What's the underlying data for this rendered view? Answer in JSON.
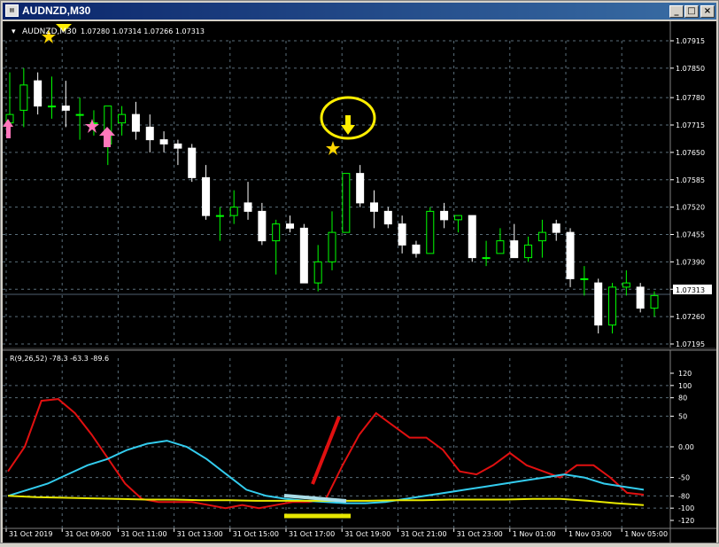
{
  "window": {
    "title": "AUDNZD,M30",
    "icon": "chart-window-icon",
    "buttons": {
      "minimize": "_",
      "maximize": "□",
      "close": "×"
    }
  },
  "header": {
    "symbol": "AUDNZD,M30",
    "ohlc": "1.07280 1.07314 1.07266 1.07313"
  },
  "indicator": {
    "label": "R(9,26,52) -78.3 -63.3 -89.6"
  },
  "current_price": "1.07313",
  "colors": {
    "bull": "#00ff00",
    "bear": "#ffffff",
    "grid": "#5a6e7a",
    "red": "#e01010",
    "cyan": "#33ccee",
    "yellow": "#e8e800",
    "pink": "#ff77bb",
    "star": "#ffd700",
    "circle": "#ffee00"
  },
  "chart_data": [
    {
      "type": "candlestick",
      "x": [
        "31 Oct 2019",
        "31 Oct 09:00",
        "31 Oct 11:00",
        "31 Oct 13:00",
        "31 Oct 15:00",
        "31 Oct 17:00",
        "31 Oct 19:00",
        "31 Oct 21:00",
        "31 Oct 23:00",
        "1 Nov 01:00",
        "1 Nov 03:00",
        "1 Nov 05:00"
      ],
      "y_ticks": [
        "1.07915",
        "1.07850",
        "1.07780",
        "1.07715",
        "1.07650",
        "1.07585",
        "1.07520",
        "1.07455",
        "1.07390",
        "1.07325",
        "1.07260",
        "1.07195"
      ],
      "ylim": [
        1.07195,
        1.07915
      ],
      "candles": [
        {
          "o": 1.0772,
          "h": 1.0784,
          "l": 1.0769,
          "c": 1.0774
        },
        {
          "o": 1.0775,
          "h": 1.0785,
          "l": 1.0771,
          "c": 1.0781
        },
        {
          "o": 1.0782,
          "h": 1.0784,
          "l": 1.0774,
          "c": 1.0776
        },
        {
          "o": 1.0776,
          "h": 1.0783,
          "l": 1.0773,
          "c": 1.0776
        },
        {
          "o": 1.0776,
          "h": 1.0782,
          "l": 1.0771,
          "c": 1.0775
        },
        {
          "o": 1.0774,
          "h": 1.0778,
          "l": 1.0768,
          "c": 1.0774
        },
        {
          "o": 1.0772,
          "h": 1.0775,
          "l": 1.0769,
          "c": 1.0772
        },
        {
          "o": 1.0767,
          "h": 1.0776,
          "l": 1.0762,
          "c": 1.0776
        },
        {
          "o": 1.0772,
          "h": 1.0776,
          "l": 1.0769,
          "c": 1.0774
        },
        {
          "o": 1.0774,
          "h": 1.0777,
          "l": 1.0768,
          "c": 1.077
        },
        {
          "o": 1.0771,
          "h": 1.0774,
          "l": 1.0765,
          "c": 1.0768
        },
        {
          "o": 1.0768,
          "h": 1.077,
          "l": 1.0765,
          "c": 1.0767
        },
        {
          "o": 1.0767,
          "h": 1.0768,
          "l": 1.0762,
          "c": 1.0766
        },
        {
          "o": 1.0766,
          "h": 1.0767,
          "l": 1.0758,
          "c": 1.0759
        },
        {
          "o": 1.0759,
          "h": 1.0762,
          "l": 1.0749,
          "c": 1.075
        },
        {
          "o": 1.075,
          "h": 1.0752,
          "l": 1.0744,
          "c": 1.075
        },
        {
          "o": 1.075,
          "h": 1.0756,
          "l": 1.0748,
          "c": 1.0752
        },
        {
          "o": 1.0753,
          "h": 1.0758,
          "l": 1.0749,
          "c": 1.0751
        },
        {
          "o": 1.0751,
          "h": 1.0753,
          "l": 1.0743,
          "c": 1.0744
        },
        {
          "o": 1.0744,
          "h": 1.0749,
          "l": 1.0736,
          "c": 1.0748
        },
        {
          "o": 1.0748,
          "h": 1.075,
          "l": 1.0746,
          "c": 1.0747
        },
        {
          "o": 1.0747,
          "h": 1.0748,
          "l": 1.0734,
          "c": 1.0734
        },
        {
          "o": 1.0734,
          "h": 1.0743,
          "l": 1.0732,
          "c": 1.0739
        },
        {
          "o": 1.0739,
          "h": 1.0751,
          "l": 1.0737,
          "c": 1.0746
        },
        {
          "o": 1.0746,
          "h": 1.076,
          "l": 1.0746,
          "c": 1.076
        },
        {
          "o": 1.076,
          "h": 1.0762,
          "l": 1.0752,
          "c": 1.0753
        },
        {
          "o": 1.0753,
          "h": 1.0756,
          "l": 1.0747,
          "c": 1.0751
        },
        {
          "o": 1.0751,
          "h": 1.0752,
          "l": 1.0747,
          "c": 1.0748
        },
        {
          "o": 1.0748,
          "h": 1.075,
          "l": 1.0741,
          "c": 1.0743
        },
        {
          "o": 1.0743,
          "h": 1.0744,
          "l": 1.074,
          "c": 1.0741
        },
        {
          "o": 1.0741,
          "h": 1.0752,
          "l": 1.0741,
          "c": 1.0751
        },
        {
          "o": 1.0751,
          "h": 1.0753,
          "l": 1.0747,
          "c": 1.0749
        },
        {
          "o": 1.0749,
          "h": 1.075,
          "l": 1.0746,
          "c": 1.075
        },
        {
          "o": 1.075,
          "h": 1.075,
          "l": 1.0739,
          "c": 1.074
        },
        {
          "o": 1.074,
          "h": 1.0744,
          "l": 1.0738,
          "c": 1.074
        },
        {
          "o": 1.0741,
          "h": 1.0747,
          "l": 1.0741,
          "c": 1.0744
        },
        {
          "o": 1.0744,
          "h": 1.0748,
          "l": 1.074,
          "c": 1.074
        },
        {
          "o": 1.074,
          "h": 1.0745,
          "l": 1.0739,
          "c": 1.0743
        },
        {
          "o": 1.0744,
          "h": 1.0749,
          "l": 1.074,
          "c": 1.0746
        },
        {
          "o": 1.0748,
          "h": 1.0749,
          "l": 1.0744,
          "c": 1.0746
        },
        {
          "o": 1.0746,
          "h": 1.0747,
          "l": 1.0733,
          "c": 1.0735
        },
        {
          "o": 1.0735,
          "h": 1.0738,
          "l": 1.0731,
          "c": 1.0735
        },
        {
          "o": 1.0734,
          "h": 1.0735,
          "l": 1.0722,
          "c": 1.0724
        },
        {
          "o": 1.0724,
          "h": 1.0734,
          "l": 1.0722,
          "c": 1.0733
        },
        {
          "o": 1.0733,
          "h": 1.0737,
          "l": 1.0731,
          "c": 1.0734
        },
        {
          "o": 1.0733,
          "h": 1.0734,
          "l": 1.0727,
          "c": 1.0728
        },
        {
          "o": 1.0728,
          "h": 1.0732,
          "l": 1.0726,
          "c": 1.0731
        }
      ]
    },
    {
      "type": "line",
      "x": [
        "31 Oct 2019",
        "31 Oct 09:00",
        "31 Oct 11:00",
        "31 Oct 13:00",
        "31 Oct 15:00",
        "31 Oct 17:00",
        "31 Oct 19:00",
        "31 Oct 21:00",
        "31 Oct 23:00",
        "1 Nov 01:00",
        "1 Nov 03:00",
        "1 Nov 05:00"
      ],
      "y_ticks": [
        "120",
        "100",
        "80",
        "50",
        "0.00",
        "-50",
        "-80",
        "-100",
        "-120"
      ],
      "ylim": [
        -120,
        120
      ],
      "series": [
        {
          "color": "red",
          "values": [
            -40,
            0,
            75,
            78,
            55,
            20,
            -20,
            -60,
            -85,
            -90,
            -90,
            -90,
            -95,
            -100,
            -95,
            -100,
            -95,
            -90,
            -90,
            -85,
            -30,
            20,
            55,
            35,
            15,
            15,
            -5,
            -40,
            -45,
            -30,
            -10,
            -30,
            -40,
            -50,
            -30,
            -30,
            -50,
            -75,
            -78
          ]
        },
        {
          "color": "cyan",
          "values": [
            -80,
            -70,
            -60,
            -45,
            -30,
            -20,
            -5,
            5,
            10,
            0,
            -20,
            -45,
            -70,
            -80,
            -85,
            -88,
            -90,
            -92,
            -92,
            -90,
            -85,
            -80,
            -75,
            -70,
            -65,
            -60,
            -55,
            -50,
            -45,
            -50,
            -60,
            -65,
            -70
          ]
        },
        {
          "color": "yellow",
          "values": [
            -80,
            -82,
            -83,
            -84,
            -85,
            -86,
            -86,
            -87,
            -87,
            -88,
            -88,
            -88,
            -88,
            -88,
            -87,
            -87,
            -86,
            -86,
            -86,
            -85,
            -85,
            -88,
            -92,
            -95
          ]
        }
      ]
    }
  ]
}
